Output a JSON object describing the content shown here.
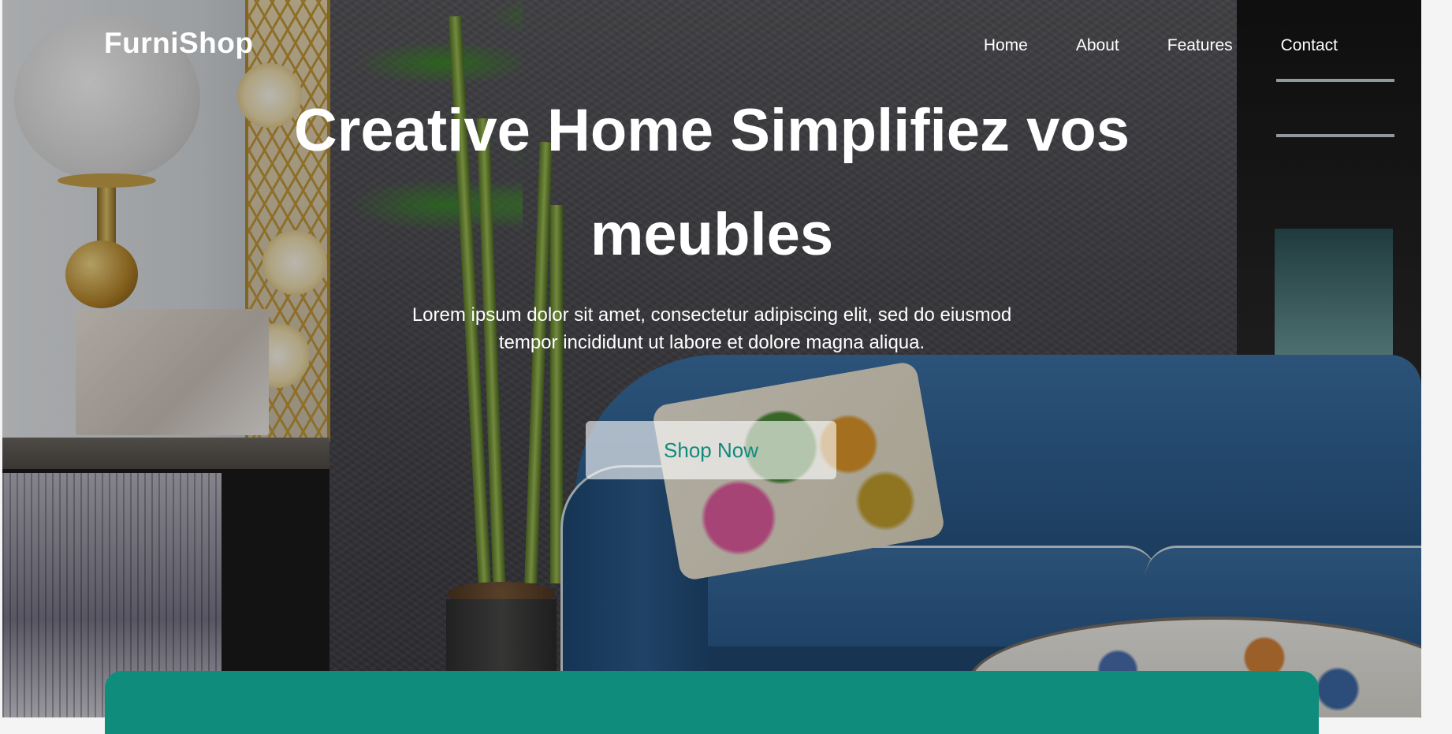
{
  "brand": {
    "logo": "FurniShop"
  },
  "nav": {
    "items": [
      "Home",
      "About",
      "Features",
      "Contact"
    ]
  },
  "hero": {
    "title": "Creative Home Simplifiez vos meubles",
    "subtitle": "Lorem ipsum dolor sit amet, consectetur adipiscing elit, sed do eiusmod tempor incididunt ut labore et dolore magna aliqua.",
    "cta_label": "Shop Now"
  },
  "colors": {
    "accent": "#0f8c7c",
    "cta_text": "#118a7e",
    "text_on_hero": "#ffffff"
  }
}
